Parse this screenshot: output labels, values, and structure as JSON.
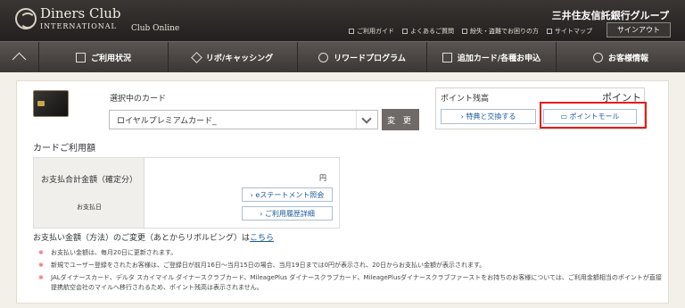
{
  "header": {
    "logo_text": "Diners Club",
    "logo_sub": "INTERNATIONAL",
    "club_online": "Club Online",
    "bank_name": "三井住友信託銀行グループ",
    "util_links": [
      "ご利用ガイド",
      "よくあるご質問",
      "紛失・盗難でお困りの方",
      "サイトマップ"
    ],
    "signout_label": "サインアウト"
  },
  "nav": {
    "items": [
      "ご利用状況",
      "リボ/キャッシング",
      "リワードプログラム",
      "追加カード/各種お申込",
      "お客様情報"
    ]
  },
  "card": {
    "label": "選択中のカード",
    "selected": "ロイヤルプレミアムカード_",
    "change_label": "変 更"
  },
  "points": {
    "title": "ポイント残高",
    "unit": "ポイント",
    "exchange_label": "特典と交換する",
    "mall_label": "ポイントモール"
  },
  "usage": {
    "title": "カードご利用額",
    "amount_label": "お支払合計金額（確定分）",
    "due_label": "お支払日",
    "yen": "円",
    "estatement_label": "eステートメント照会",
    "history_label": "ご利用履歴詳細"
  },
  "method": {
    "text": "お支払い金額（方法）のご変更（あとからリボルビング）は",
    "link": "こちら"
  },
  "notes": [
    "お支払い金額は、毎月20日に更新されます。",
    "新規でユーザー登録をされたお客様は、ご登録日が前月16日～当月15日の場合、当月19日までは0円が表示され、20日からお支払い金額が表示されます。",
    "JALダイナースカード、デルタ スカイマイル ダイナースクラブカード、MileagePlus ダイナースクラブカード、MileagePlusダイナースクラブファーストをお持ちのお客様については、ご利用金額相当のポイントが直接提携航空会社のマイルへ移行されるため、ポイント残高は表示されません。"
  ]
}
